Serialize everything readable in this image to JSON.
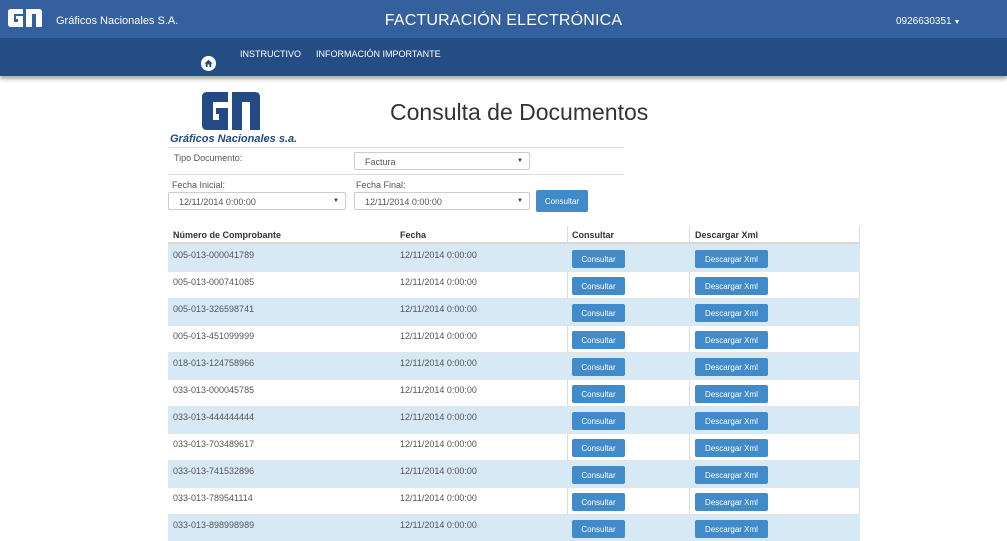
{
  "topbar": {
    "brand_name": "Gráficos Nacionales S.A.",
    "app_title": "FACTURACIÓN ELECTRÓNICA",
    "user": "0926630351",
    "bg_color": "#34609e"
  },
  "nav": {
    "home_icon": "home-icon",
    "items": [
      {
        "label": "INSTRUCTIVO"
      },
      {
        "label": "INFORMACIÓN IMPORTANTE"
      }
    ]
  },
  "page": {
    "logo_text": "Gráficos Nacionales s.a.",
    "heading": "Consulta de Documentos"
  },
  "filters": {
    "tipo_label": "Tipo Documento:",
    "tipo_value": "Factura",
    "fecha_inicial_label": "Fecha Inicial:",
    "fecha_inicial_value": "12/11/2014 0:00:00",
    "fecha_final_label": "Fecha Final:",
    "fecha_final_value": "12/11/2014 0:00:00",
    "consultar_label": "Consultar"
  },
  "table": {
    "headers": [
      "Número de Comprobante",
      "Fecha",
      "Consultar",
      "Descargar Xml"
    ],
    "consultar_label": "Consultar",
    "descargar_label": "Descargar Xml",
    "rows": [
      {
        "numero": "005-013-000041789",
        "fecha": "12/11/2014 0:00:00"
      },
      {
        "numero": "005-013-000741085",
        "fecha": "12/11/2014 0:00:00"
      },
      {
        "numero": "005-013-326598741",
        "fecha": "12/11/2014 0:00:00"
      },
      {
        "numero": "005-013-451099999",
        "fecha": "12/11/2014 0:00:00"
      },
      {
        "numero": "018-013-124758966",
        "fecha": "12/11/2014 0:00:00"
      },
      {
        "numero": "033-013-000045785",
        "fecha": "12/11/2014 0:00:00"
      },
      {
        "numero": "033-013-444444444",
        "fecha": "12/11/2014 0:00:00"
      },
      {
        "numero": "033-013-703489617",
        "fecha": "12/11/2014 0:00:00"
      },
      {
        "numero": "033-013-741532896",
        "fecha": "12/11/2014 0:00:00"
      },
      {
        "numero": "033-013-789541114",
        "fecha": "12/11/2014 0:00:00"
      },
      {
        "numero": "033-013-898998989",
        "fecha": "12/11/2014 0:00:00"
      }
    ]
  },
  "colors": {
    "header_blue": "#34609e",
    "nav_blue": "#254d85",
    "button_blue": "#428bca",
    "row_stripe": "#d8e9f6"
  }
}
